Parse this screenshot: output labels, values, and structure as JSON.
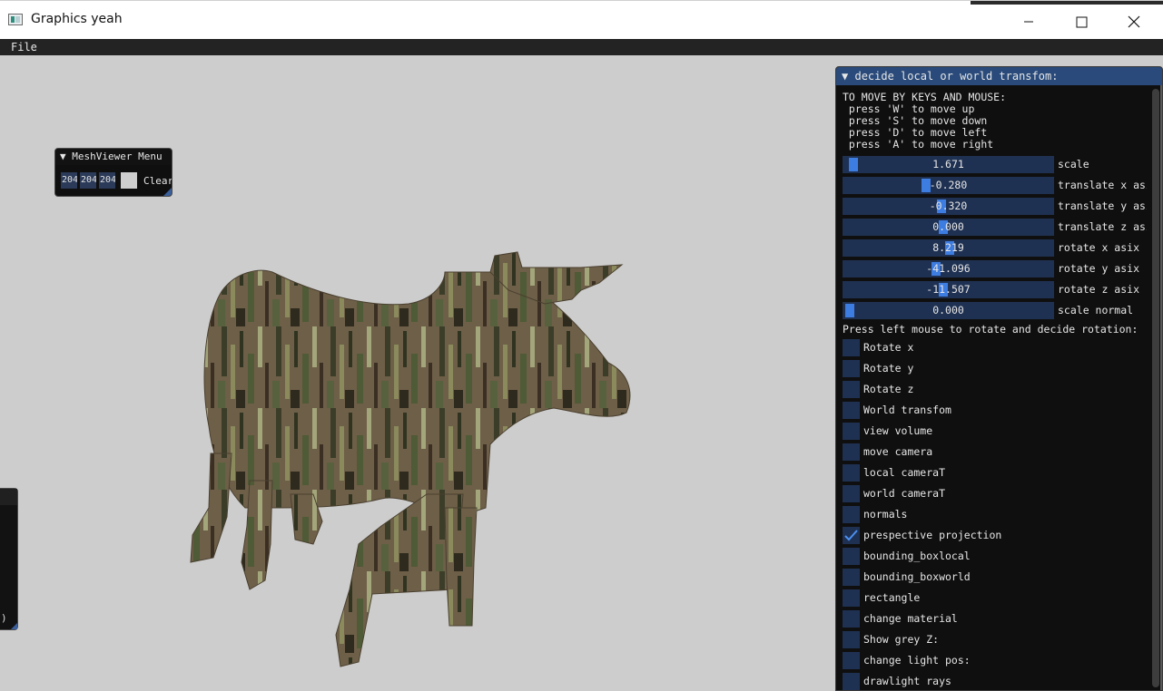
{
  "window": {
    "title": "Graphics yeah",
    "minimize_icon": "minimize-icon",
    "maximize_icon": "maximize-icon",
    "close_icon": "close-icon"
  },
  "menubar": {
    "file_label": "File"
  },
  "mesh_menu": {
    "title": "MeshViewer Menu",
    "color_r": "204",
    "color_g": "204",
    "color_b": "204",
    "clear_label": "Clear"
  },
  "left_window": {
    "tail_text": ")"
  },
  "panel": {
    "title": "decide local or world transfom:",
    "instructions": [
      "TO MOVE BY KEYS AND MOUSE:",
      " press 'W' to move up",
      " press 'S' to move down",
      " press 'D' to move left",
      " press 'A' to move right"
    ],
    "sliders": [
      {
        "value": "1.671",
        "label": "scale",
        "grab": 0.02
      },
      {
        "value": "-0.280",
        "label": "translate x asix",
        "grab": 0.38
      },
      {
        "value": "-0.320",
        "label": "translate y asix",
        "grab": 0.46
      },
      {
        "value": "0.000",
        "label": "translate z asix",
        "grab": 0.47
      },
      {
        "value": "8.219",
        "label": "rotate x asix",
        "grab": 0.5
      },
      {
        "value": "-41.096",
        "label": "rotate y asix",
        "grab": 0.43
      },
      {
        "value": "-11.507",
        "label": "rotate z asix",
        "grab": 0.47
      },
      {
        "value": "0.000",
        "label": "scale normal",
        "grab": 0.0
      }
    ],
    "rotation_prompt": "Press left mouse to rotate and decide rotation:",
    "checkboxes": [
      {
        "label": "Rotate x",
        "checked": false
      },
      {
        "label": "Rotate y",
        "checked": false
      },
      {
        "label": "Rotate z",
        "checked": false
      },
      {
        "label": "World transfom",
        "checked": false
      },
      {
        "label": "view volume",
        "checked": false
      },
      {
        "label": "move camera",
        "checked": false
      },
      {
        "label": "local cameraT",
        "checked": false
      },
      {
        "label": "world cameraT",
        "checked": false
      },
      {
        "label": "normals",
        "checked": false
      },
      {
        "label": "prespective projection",
        "checked": true
      },
      {
        "label": "bounding_boxlocal",
        "checked": false
      },
      {
        "label": "bounding_boxworld",
        "checked": false
      },
      {
        "label": "rectangle",
        "checked": false
      },
      {
        "label": "change material",
        "checked": false
      },
      {
        "label": "Show grey Z:",
        "checked": false
      },
      {
        "label": "change light pos:",
        "checked": false
      },
      {
        "label": "drawlight rays",
        "checked": false
      }
    ]
  },
  "colors": {
    "viewport_bg": "#cdcdcd",
    "panel_bg": "#0f0f0f",
    "header_blue": "#294a7a",
    "frame_bg": "#1f3152",
    "accent_blue": "#3d7ce0",
    "cow_base": "#6e5f48"
  }
}
